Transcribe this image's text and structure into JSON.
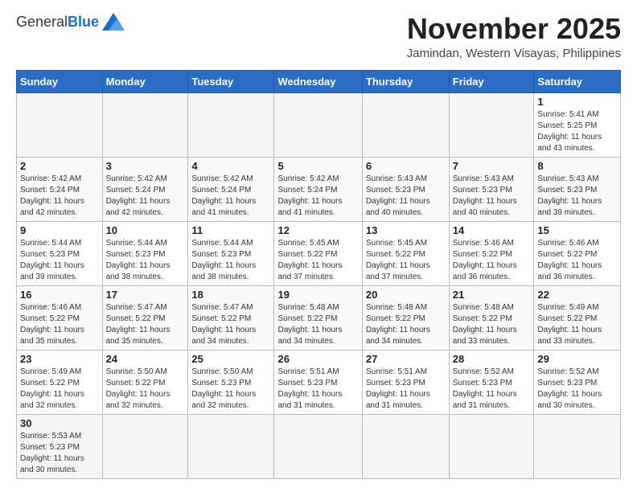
{
  "header": {
    "logo_general": "General",
    "logo_blue": "Blue",
    "month_title": "November 2025",
    "location": "Jamindan, Western Visayas, Philippines"
  },
  "columns": [
    "Sunday",
    "Monday",
    "Tuesday",
    "Wednesday",
    "Thursday",
    "Friday",
    "Saturday"
  ],
  "weeks": [
    [
      {
        "day": "",
        "info": ""
      },
      {
        "day": "",
        "info": ""
      },
      {
        "day": "",
        "info": ""
      },
      {
        "day": "",
        "info": ""
      },
      {
        "day": "",
        "info": ""
      },
      {
        "day": "",
        "info": ""
      },
      {
        "day": "1",
        "info": "Sunrise: 5:41 AM\nSunset: 5:25 PM\nDaylight: 11 hours\nand 43 minutes."
      }
    ],
    [
      {
        "day": "2",
        "info": "Sunrise: 5:42 AM\nSunset: 5:24 PM\nDaylight: 11 hours\nand 42 minutes."
      },
      {
        "day": "3",
        "info": "Sunrise: 5:42 AM\nSunset: 5:24 PM\nDaylight: 11 hours\nand 42 minutes."
      },
      {
        "day": "4",
        "info": "Sunrise: 5:42 AM\nSunset: 5:24 PM\nDaylight: 11 hours\nand 41 minutes."
      },
      {
        "day": "5",
        "info": "Sunrise: 5:42 AM\nSunset: 5:24 PM\nDaylight: 11 hours\nand 41 minutes."
      },
      {
        "day": "6",
        "info": "Sunrise: 5:43 AM\nSunset: 5:23 PM\nDaylight: 11 hours\nand 40 minutes."
      },
      {
        "day": "7",
        "info": "Sunrise: 5:43 AM\nSunset: 5:23 PM\nDaylight: 11 hours\nand 40 minutes."
      },
      {
        "day": "8",
        "info": "Sunrise: 5:43 AM\nSunset: 5:23 PM\nDaylight: 11 hours\nand 39 minutes."
      }
    ],
    [
      {
        "day": "9",
        "info": "Sunrise: 5:44 AM\nSunset: 5:23 PM\nDaylight: 11 hours\nand 39 minutes."
      },
      {
        "day": "10",
        "info": "Sunrise: 5:44 AM\nSunset: 5:23 PM\nDaylight: 11 hours\nand 38 minutes."
      },
      {
        "day": "11",
        "info": "Sunrise: 5:44 AM\nSunset: 5:23 PM\nDaylight: 11 hours\nand 38 minutes."
      },
      {
        "day": "12",
        "info": "Sunrise: 5:45 AM\nSunset: 5:22 PM\nDaylight: 11 hours\nand 37 minutes."
      },
      {
        "day": "13",
        "info": "Sunrise: 5:45 AM\nSunset: 5:22 PM\nDaylight: 11 hours\nand 37 minutes."
      },
      {
        "day": "14",
        "info": "Sunrise: 5:46 AM\nSunset: 5:22 PM\nDaylight: 11 hours\nand 36 minutes."
      },
      {
        "day": "15",
        "info": "Sunrise: 5:46 AM\nSunset: 5:22 PM\nDaylight: 11 hours\nand 36 minutes."
      }
    ],
    [
      {
        "day": "16",
        "info": "Sunrise: 5:46 AM\nSunset: 5:22 PM\nDaylight: 11 hours\nand 35 minutes."
      },
      {
        "day": "17",
        "info": "Sunrise: 5:47 AM\nSunset: 5:22 PM\nDaylight: 11 hours\nand 35 minutes."
      },
      {
        "day": "18",
        "info": "Sunrise: 5:47 AM\nSunset: 5:22 PM\nDaylight: 11 hours\nand 34 minutes."
      },
      {
        "day": "19",
        "info": "Sunrise: 5:48 AM\nSunset: 5:22 PM\nDaylight: 11 hours\nand 34 minutes."
      },
      {
        "day": "20",
        "info": "Sunrise: 5:48 AM\nSunset: 5:22 PM\nDaylight: 11 hours\nand 34 minutes."
      },
      {
        "day": "21",
        "info": "Sunrise: 5:48 AM\nSunset: 5:22 PM\nDaylight: 11 hours\nand 33 minutes."
      },
      {
        "day": "22",
        "info": "Sunrise: 5:49 AM\nSunset: 5:22 PM\nDaylight: 11 hours\nand 33 minutes."
      }
    ],
    [
      {
        "day": "23",
        "info": "Sunrise: 5:49 AM\nSunset: 5:22 PM\nDaylight: 11 hours\nand 32 minutes."
      },
      {
        "day": "24",
        "info": "Sunrise: 5:50 AM\nSunset: 5:22 PM\nDaylight: 11 hours\nand 32 minutes."
      },
      {
        "day": "25",
        "info": "Sunrise: 5:50 AM\nSunset: 5:23 PM\nDaylight: 11 hours\nand 32 minutes."
      },
      {
        "day": "26",
        "info": "Sunrise: 5:51 AM\nSunset: 5:23 PM\nDaylight: 11 hours\nand 31 minutes."
      },
      {
        "day": "27",
        "info": "Sunrise: 5:51 AM\nSunset: 5:23 PM\nDaylight: 11 hours\nand 31 minutes."
      },
      {
        "day": "28",
        "info": "Sunrise: 5:52 AM\nSunset: 5:23 PM\nDaylight: 11 hours\nand 31 minutes."
      },
      {
        "day": "29",
        "info": "Sunrise: 5:52 AM\nSunset: 5:23 PM\nDaylight: 11 hours\nand 30 minutes."
      }
    ],
    [
      {
        "day": "30",
        "info": "Sunrise: 5:53 AM\nSunset: 5:23 PM\nDaylight: 11 hours\nand 30 minutes."
      },
      {
        "day": "",
        "info": ""
      },
      {
        "day": "",
        "info": ""
      },
      {
        "day": "",
        "info": ""
      },
      {
        "day": "",
        "info": ""
      },
      {
        "day": "",
        "info": ""
      },
      {
        "day": "",
        "info": ""
      }
    ]
  ]
}
